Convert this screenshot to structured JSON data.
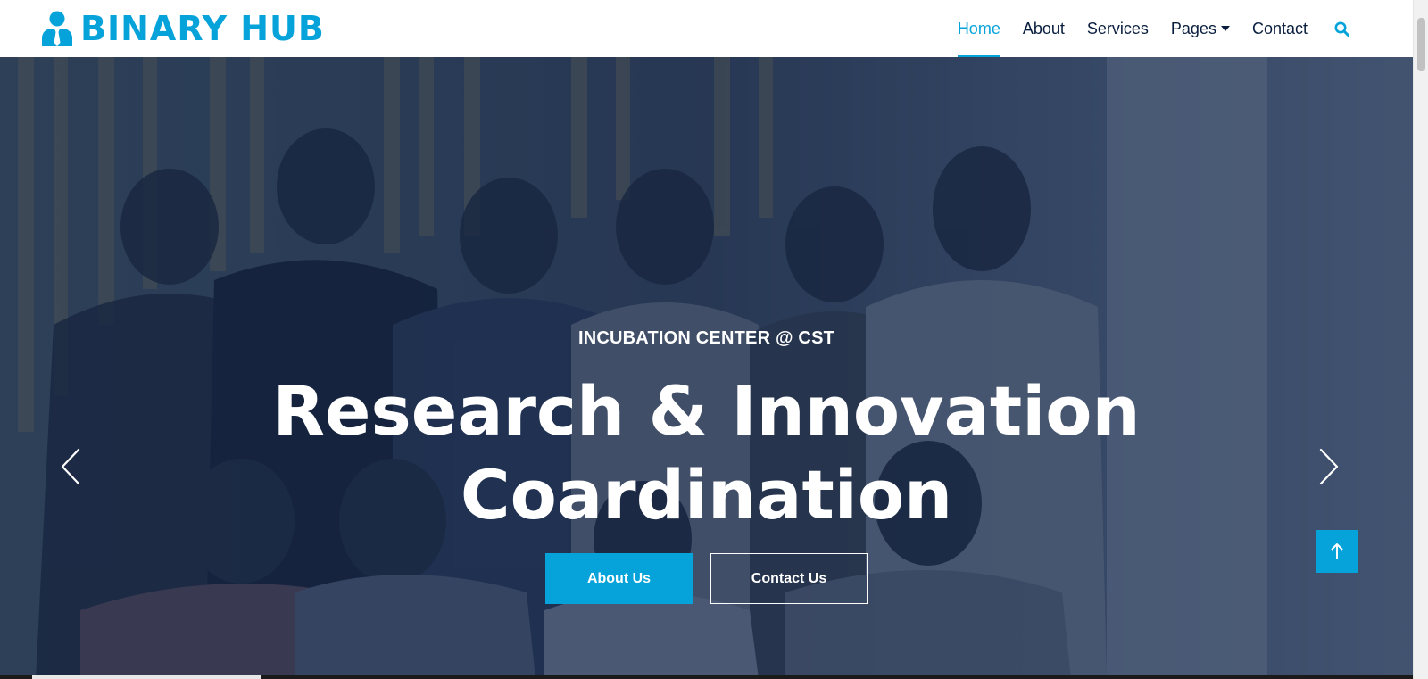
{
  "brand": {
    "name": "BINARY HUB",
    "icon": "user-tie-icon",
    "color": "#06A3DA"
  },
  "nav": {
    "items": [
      {
        "label": "Home",
        "active": true
      },
      {
        "label": "About",
        "active": false
      },
      {
        "label": "Services",
        "active": false
      },
      {
        "label": "Pages",
        "active": false,
        "dropdown": true
      },
      {
        "label": "Contact",
        "active": false
      }
    ],
    "search_icon": "search-icon"
  },
  "hero": {
    "eyebrow": "INCUBATION CENTER @ CST",
    "headline_line1": "Research & Innovation",
    "headline_line2": "Coardination",
    "primary_button": "About Us",
    "secondary_button": "Contact Us",
    "prev_icon": "chevron-left-icon",
    "next_icon": "chevron-right-icon",
    "background": "group-photo"
  },
  "back_to_top": {
    "icon": "arrow-up-icon"
  },
  "colors": {
    "accent": "#06A3DA",
    "dark": "#091E3E",
    "white": "#ffffff"
  }
}
